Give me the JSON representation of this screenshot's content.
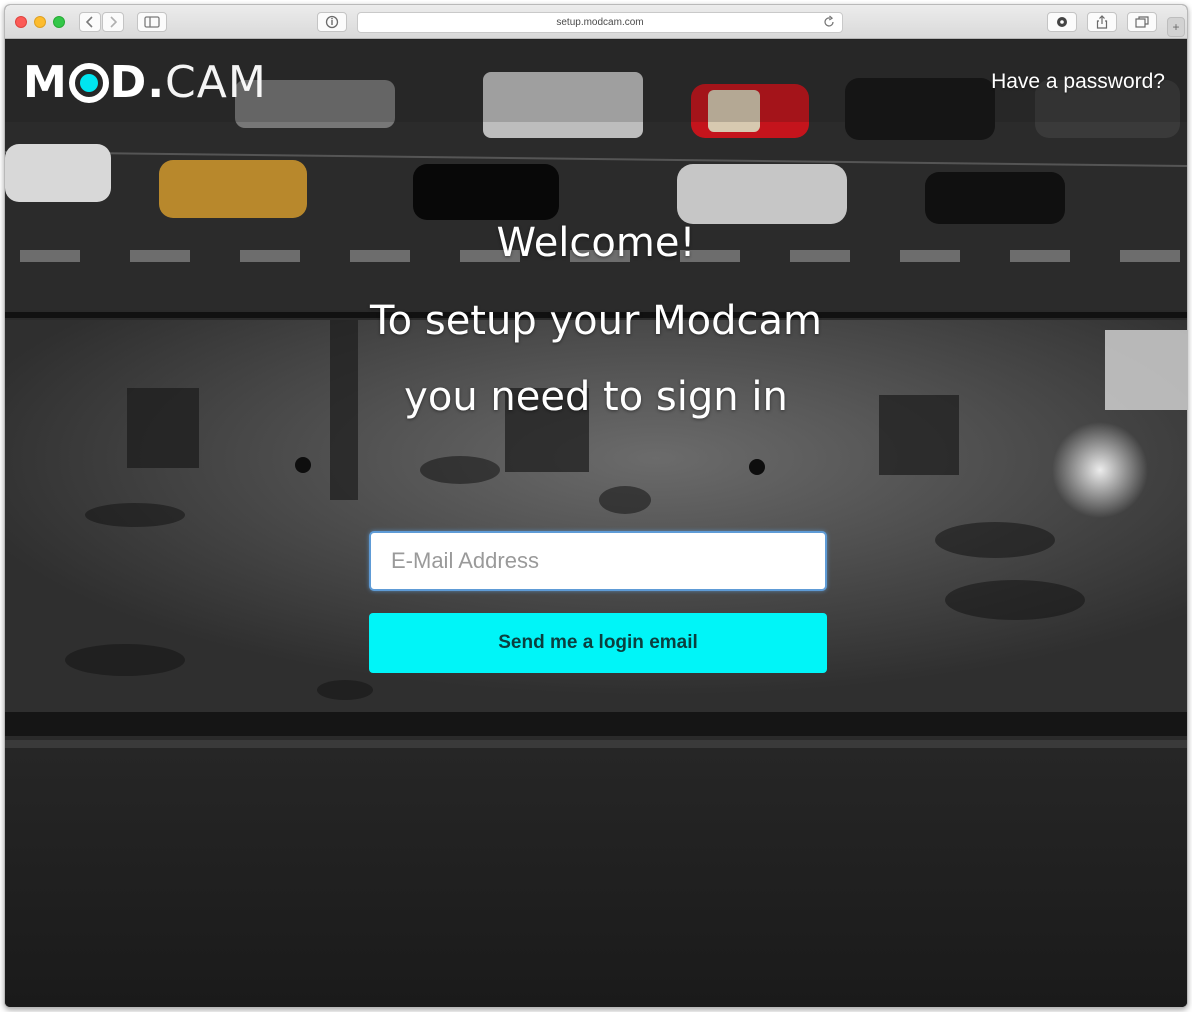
{
  "browser": {
    "url": "setup.modcam.com"
  },
  "brand": {
    "logo_text_start": "M",
    "logo_text_middle": "D.",
    "logo_text_end": "CAM",
    "accent_color": "#00e5f0"
  },
  "nav": {
    "password_link": "Have a password?"
  },
  "hero": {
    "line1": "Welcome!",
    "line2": "To setup your Modcam",
    "line3": "you need to sign in"
  },
  "form": {
    "email_placeholder": "E-Mail Address",
    "email_value": "",
    "submit_label": "Send me a login email",
    "button_color": "#00f5f8"
  },
  "icons": {
    "back": "chevron-left-icon",
    "forward": "chevron-right-icon",
    "sidebar": "sidebar-icon",
    "privacy": "info-icon",
    "reload": "reload-icon",
    "extension": "extension-icon",
    "share": "share-icon",
    "tabs": "tabs-icon",
    "new_tab": "plus-icon"
  }
}
